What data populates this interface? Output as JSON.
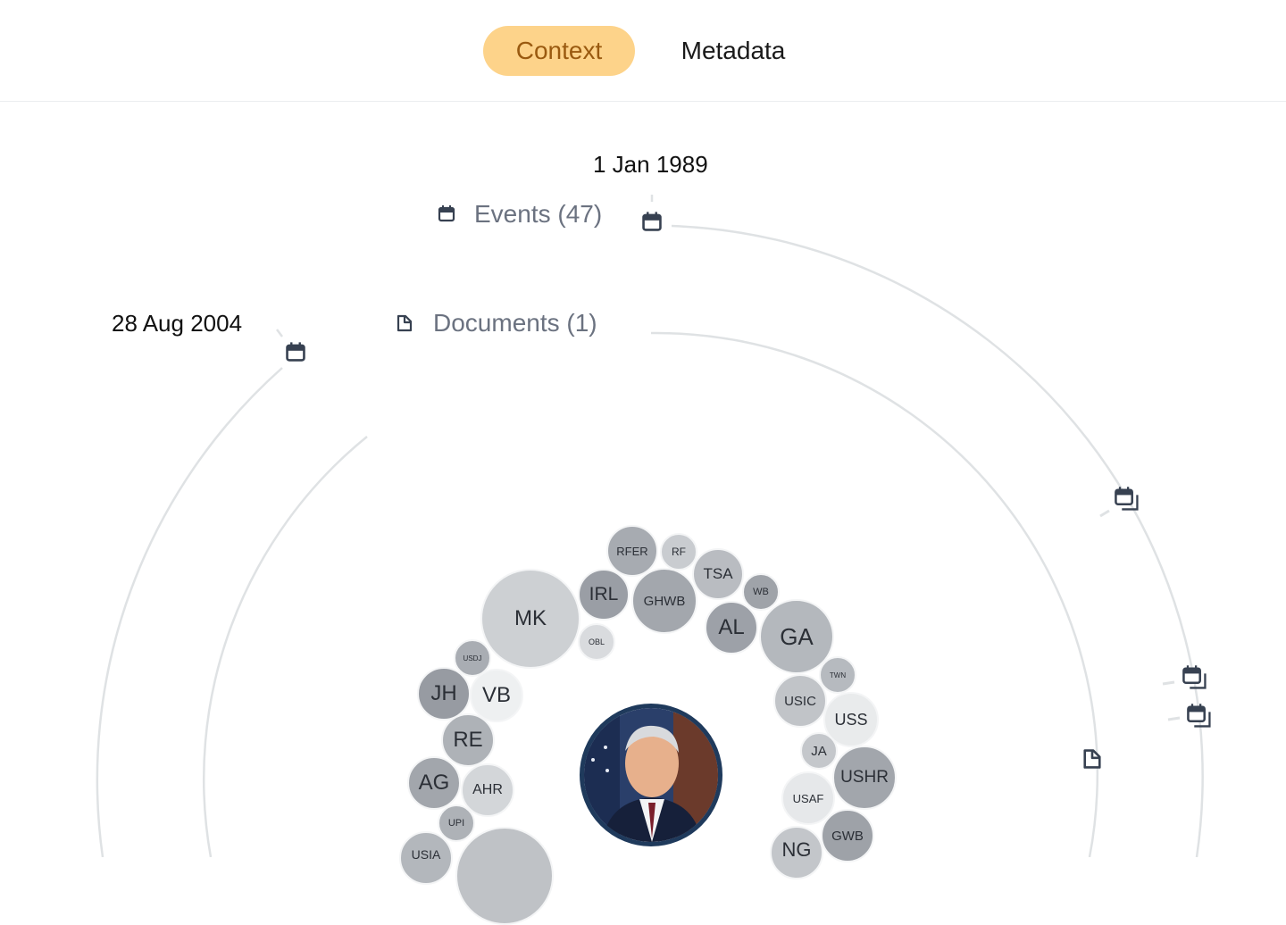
{
  "tabs": [
    {
      "label": "Context",
      "active": true
    },
    {
      "label": "Metadata",
      "active": false
    }
  ],
  "timeline": {
    "start_date": "1 Jan 1989",
    "end_date": "28 Aug 2004"
  },
  "categories": {
    "events_label": "Events (47)",
    "documents_label": "Documents (1)"
  },
  "entities": [
    {
      "abbr": "RFER"
    },
    {
      "abbr": "RF"
    },
    {
      "abbr": "TSA"
    },
    {
      "abbr": "WB"
    },
    {
      "abbr": "IRL"
    },
    {
      "abbr": "GHWB"
    },
    {
      "abbr": "MK"
    },
    {
      "abbr": "AL"
    },
    {
      "abbr": "GA"
    },
    {
      "abbr": "OBL"
    },
    {
      "abbr": "USDJ"
    },
    {
      "abbr": "TWN"
    },
    {
      "abbr": "JH"
    },
    {
      "abbr": "VB"
    },
    {
      "abbr": "USIC"
    },
    {
      "abbr": "USS"
    },
    {
      "abbr": "RE"
    },
    {
      "abbr": "JA"
    },
    {
      "abbr": "USHR"
    },
    {
      "abbr": "AG"
    },
    {
      "abbr": "AHR"
    },
    {
      "abbr": "USAF"
    },
    {
      "abbr": "UPI"
    },
    {
      "abbr": "GWB"
    },
    {
      "abbr": "USIA"
    },
    {
      "abbr": "NG"
    },
    {
      "abbr": ""
    }
  ],
  "colors": {
    "accent_tab_bg": "#fdd38a",
    "accent_tab_text": "#9a5a10",
    "ring_stroke": "#dfe2e4",
    "icon_color": "#374151",
    "muted_text": "#6b7280",
    "photo_border": "#1f3a5c"
  },
  "icons": {
    "event": "calendar-icon",
    "event_stack": "calendar-stack-icon",
    "document": "document-icon"
  }
}
